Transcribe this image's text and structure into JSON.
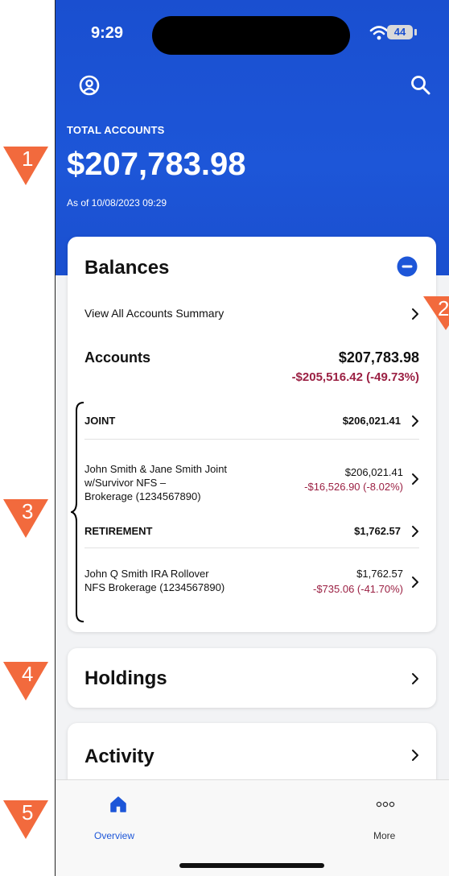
{
  "status_bar": {
    "time": "9:29",
    "battery": "44"
  },
  "header": {
    "label": "TOTAL ACCOUNTS",
    "total": "$207,783.98",
    "as_of": "As of 10/08/2023 09:29"
  },
  "balances": {
    "title": "Balances",
    "view_all": "View All Accounts Summary",
    "accounts_label": "Accounts",
    "accounts_total": "$207,783.98",
    "accounts_change": "-$205,516.42 (-49.73%)",
    "groups": [
      {
        "name": "JOINT",
        "total": "$206,021.41",
        "account_name": [
          "John Smith & Jane Smith Joint",
          "w/Survivor NFS –",
          "Brokerage (1234567890)"
        ],
        "account_value": "$206,021.41",
        "account_change": "-$16,526.90 (-8.02%)"
      },
      {
        "name": "RETIREMENT",
        "total": "$1,762.57",
        "account_name": [
          "John Q Smith IRA Rollover",
          "NFS Brokerage (1234567890)"
        ],
        "account_value": "$1,762.57",
        "account_change": "-$735.06 (-41.70%)"
      }
    ]
  },
  "holdings": {
    "title": "Holdings"
  },
  "activity": {
    "title": "Activity"
  },
  "nav": {
    "overview": "Overview",
    "more": "More"
  },
  "markers": [
    "1",
    "2",
    "3",
    "4",
    "5"
  ],
  "colors": {
    "header_blue": "#1d56d8",
    "negative": "#9b2043",
    "marker": "#f26a3d"
  }
}
